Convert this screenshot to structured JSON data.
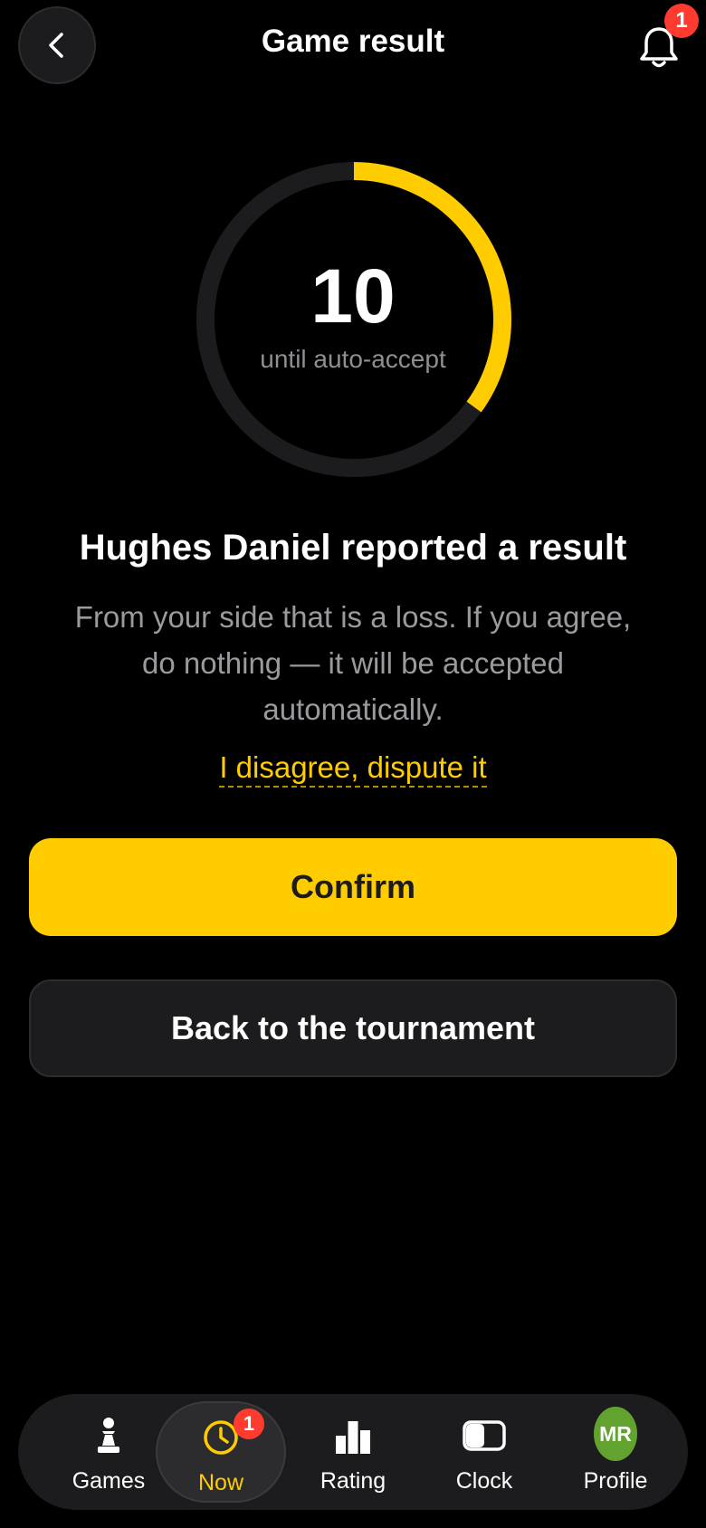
{
  "header": {
    "title": "Game result",
    "notification_count": "1"
  },
  "countdown": {
    "value": "10",
    "label": "until auto-accept",
    "progress_fraction": 0.35,
    "accent_color": "#ffcc00",
    "track_color": "#1c1c1e"
  },
  "report": {
    "title": "Hughes Daniel reported a result",
    "body": "From your side that is a loss. If you agree, do nothing — it will be accepted automatically.",
    "dispute_label": "I disagree, dispute it"
  },
  "actions": {
    "confirm_label": "Confirm",
    "back_label": "Back to the tournament"
  },
  "tabbar": {
    "items": [
      {
        "label": "Games",
        "icon": "pawn-icon"
      },
      {
        "label": "Now",
        "icon": "clock-icon",
        "badge": "1",
        "active": true
      },
      {
        "label": "Rating",
        "icon": "bar-chart-icon"
      },
      {
        "label": "Clock",
        "icon": "chess-clock-icon"
      },
      {
        "label": "Profile",
        "icon": "avatar",
        "avatar_initials": "MR",
        "avatar_color": "#62a330"
      }
    ]
  }
}
